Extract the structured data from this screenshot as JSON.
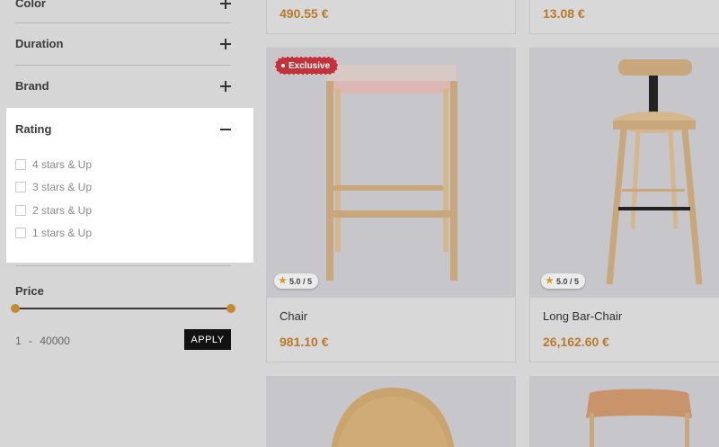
{
  "filters": {
    "color": "Color",
    "duration": "Duration",
    "brand": "Brand",
    "rating": {
      "title": "Rating",
      "options": [
        "4 stars & Up",
        "3 stars & Up",
        "2 stars & Up",
        "1 stars & Up"
      ]
    },
    "price": {
      "title": "Price",
      "min": "1",
      "separator": "-",
      "max": "40000",
      "apply": "APPLY"
    }
  },
  "products": [
    {
      "price": "490.55 €"
    },
    {
      "price": "13.08 €"
    },
    {
      "name": "Chair",
      "price": "981.10 €",
      "badge": "Exclusive",
      "rating": "5.0 / 5"
    },
    {
      "name": "Long Bar-Chair",
      "price": "26,162.60 €",
      "rating": "5.0 / 5"
    },
    {},
    {}
  ],
  "icons": {
    "expand": "plus-icon",
    "collapse": "minus-icon",
    "star": "star-icon"
  },
  "colors": {
    "accent": "#c58932",
    "price": "#b97a2a",
    "badge": "#c1323b",
    "apply_bg": "#121212"
  }
}
